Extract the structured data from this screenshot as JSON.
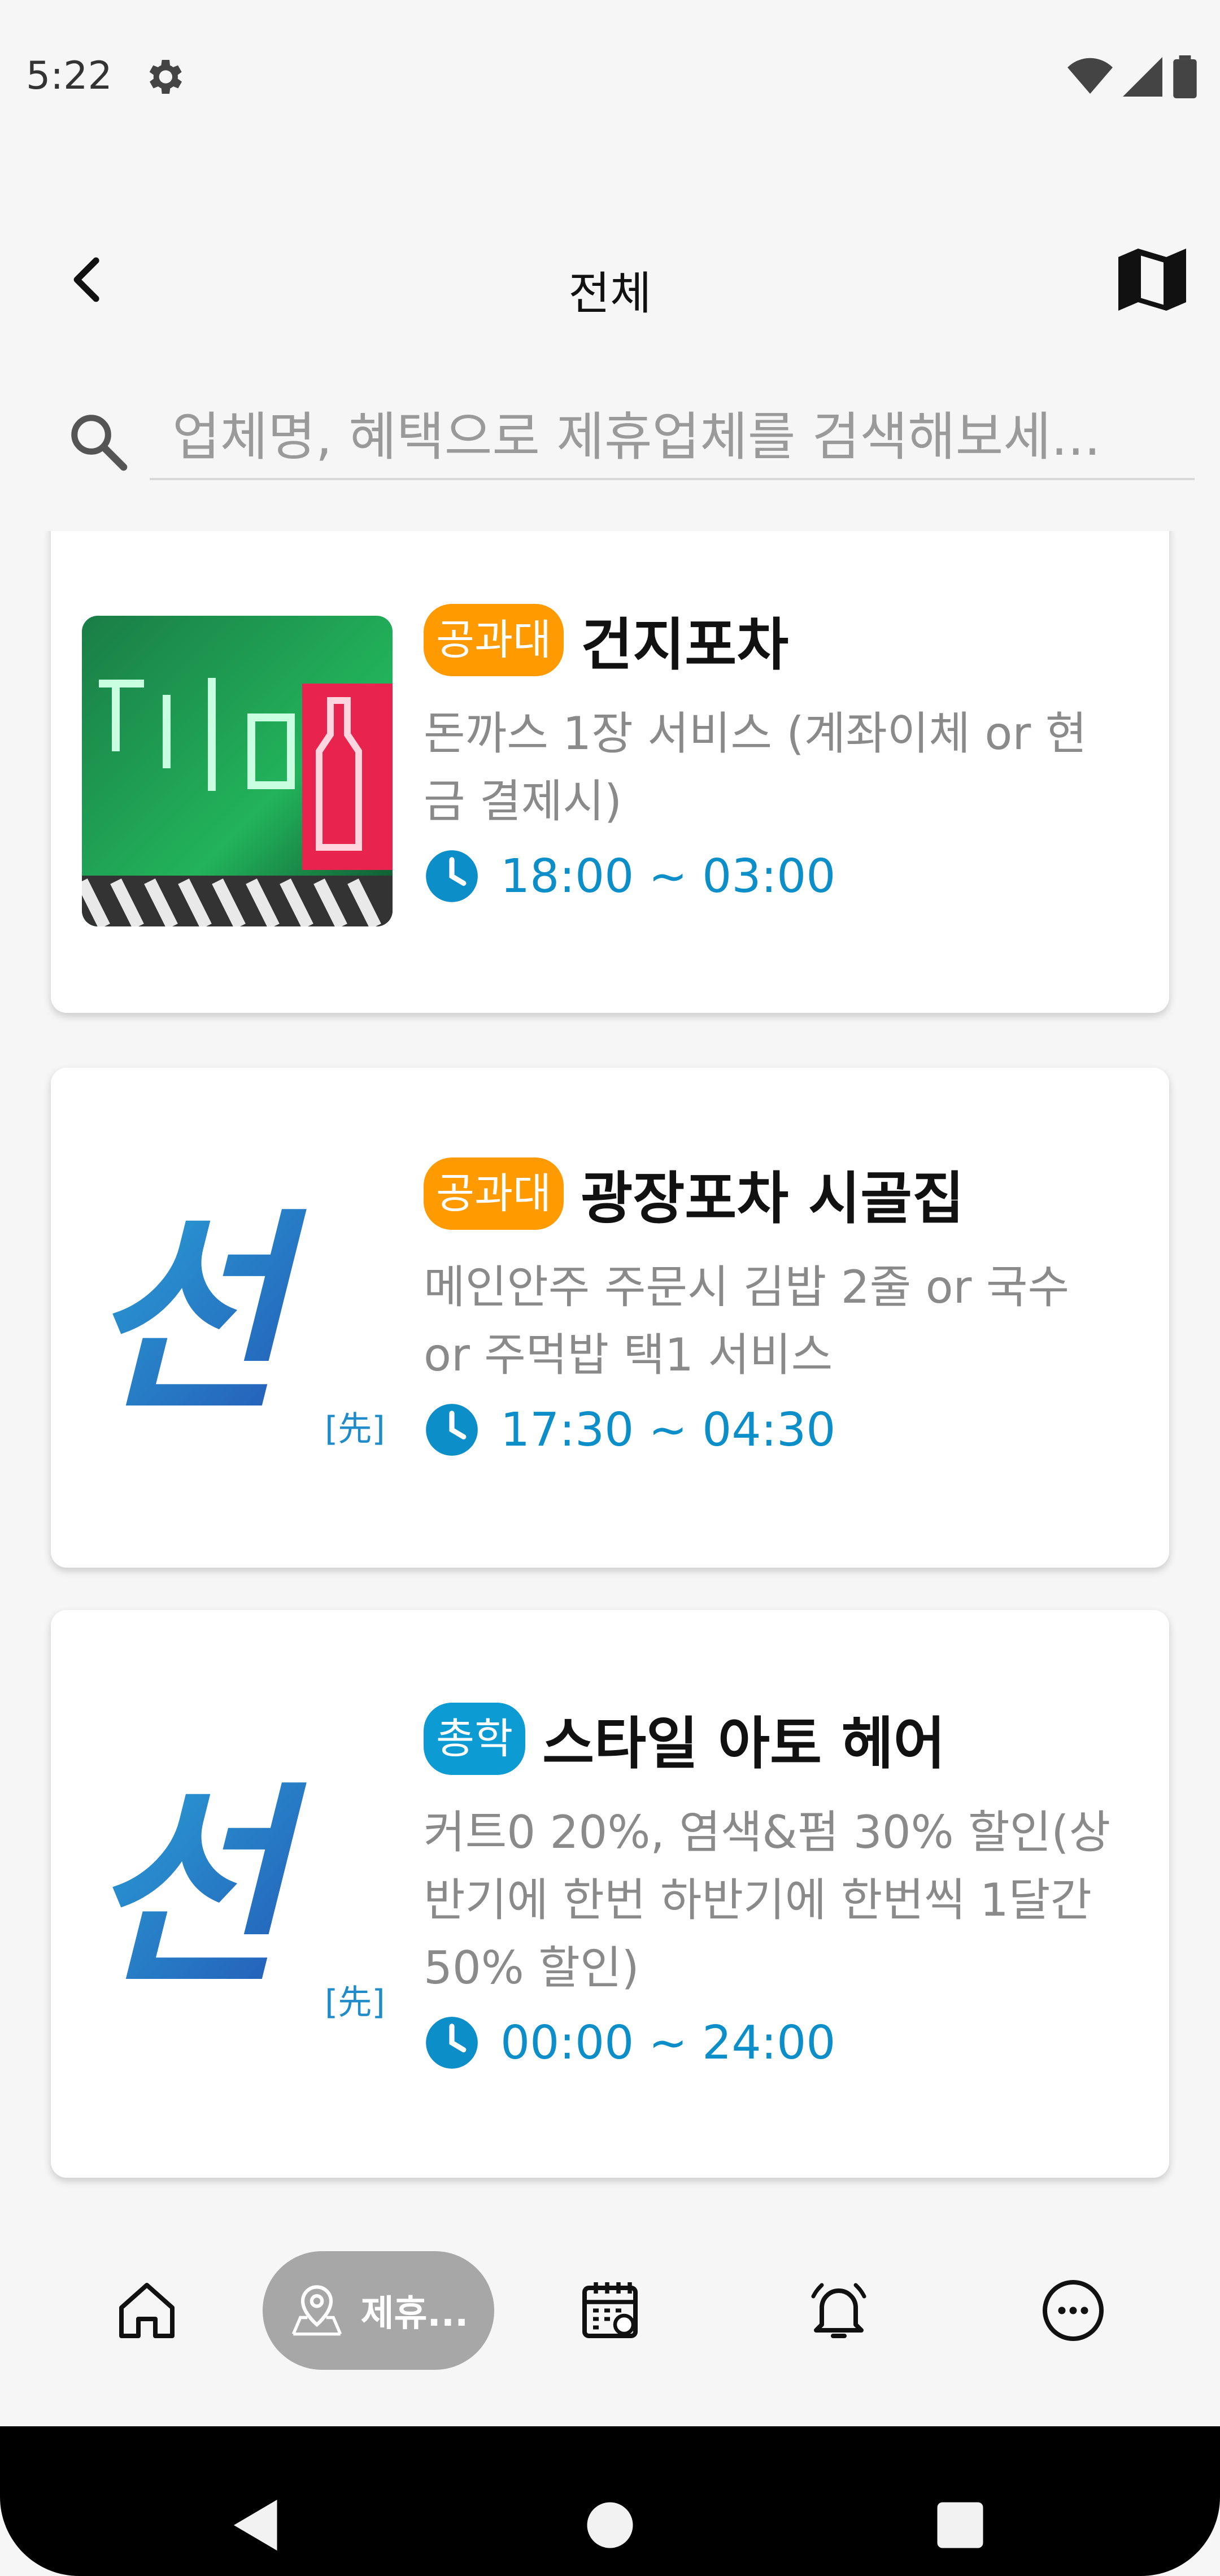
{
  "status_bar": {
    "time": "5:22"
  },
  "header": {
    "title": "전체"
  },
  "search": {
    "placeholder": "업체명, 혜택으로 제휴업체를 검색해보세..."
  },
  "logo": {
    "text": "선",
    "sub": "[先]"
  },
  "cards": [
    {
      "tag": "공과대",
      "tag_color": "#ff9a00",
      "name": "건지포차",
      "benefit": "돈까스 1장 서비스 (계좌이체 or 현금 결제시)",
      "hours": "18:00 ~ 03:00",
      "thumb": "photo"
    },
    {
      "tag": "공과대",
      "tag_color": "#ff9a00",
      "name": "광장포차 시골집",
      "benefit": "메인안주 주문시 김밥 2줄 or 국수 or 주먹밥 택1 서비스",
      "hours": "17:30 ~ 04:30",
      "thumb": "logo"
    },
    {
      "tag": "총학",
      "tag_color": "#0c9bd2",
      "name": "스타일 아토 헤어",
      "benefit": "커트0 20%, 염색&펌 30% 할인(상반기에 한번 하반기에 한번씩 1달간 50% 할인)",
      "hours": "00:00 ~ 24:00",
      "thumb": "logo"
    }
  ],
  "bottom_nav": {
    "items": [
      {
        "icon": "home-icon"
      },
      {
        "icon": "map-pin-icon",
        "label": "제휴...",
        "active": true
      },
      {
        "icon": "calendar-icon"
      },
      {
        "icon": "bell-icon"
      },
      {
        "icon": "more-icon"
      }
    ]
  },
  "colors": {
    "orange_tag": "#ff9a00",
    "blue_tag": "#0c9bd2",
    "hours_blue": "#0c8ec9",
    "logo_blue": "#1f6fc2"
  }
}
